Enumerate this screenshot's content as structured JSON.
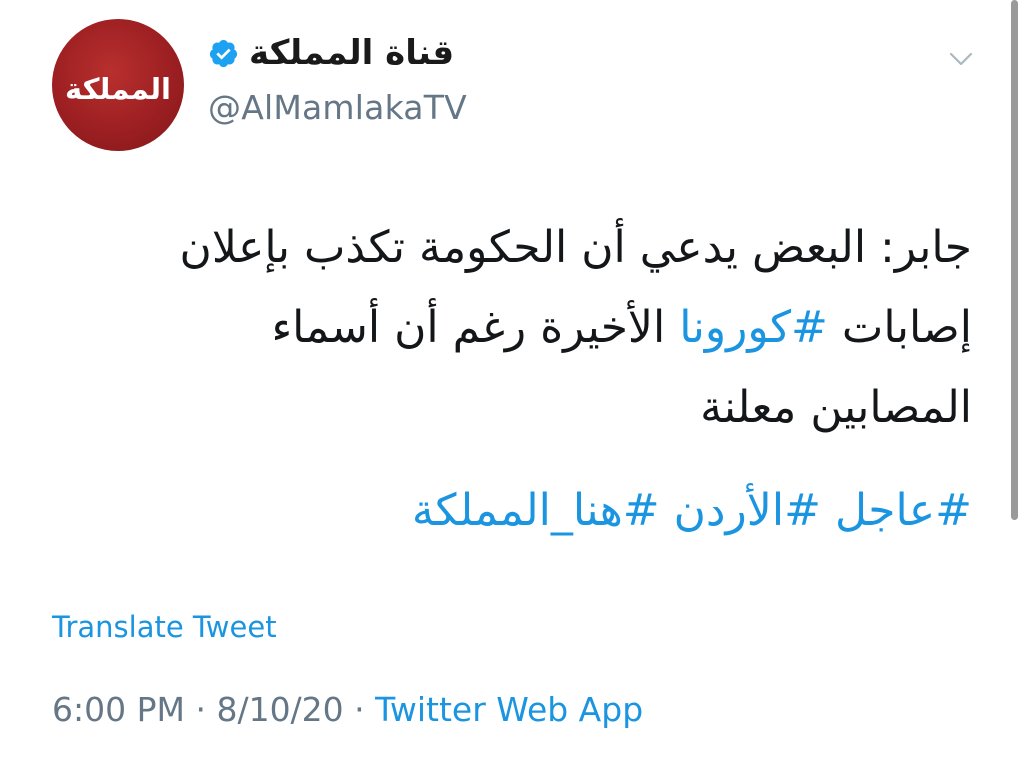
{
  "account": {
    "display_name": "قناة المملكة",
    "handle": "@AlMamlakaTV",
    "verified": true,
    "avatar_text": "المملكة",
    "avatar_color": "#9d1f22",
    "verified_icon": "verified-badge-icon"
  },
  "menu": {
    "icon": "chevron-down-icon"
  },
  "tweet": {
    "line1": "جابر: البعض يدعي أن الحكومة تكذب بإعلان",
    "line2_before": "إصابات ",
    "line2_hashtag": "#كورونا",
    "line2_after": " الأخيرة رغم أن أسماء",
    "line3": "المصابين معلنة",
    "hashtags": "#عاجل #الأردن #هنا_المملكة"
  },
  "actions": {
    "translate_label": "Translate Tweet"
  },
  "meta": {
    "time": "6:00 PM",
    "sep1": " · ",
    "date": "8/10/20",
    "sep2": " · ",
    "source": "Twitter Web App"
  },
  "colors": {
    "link": "#1b95e0",
    "secondary_text": "#657786",
    "primary_text": "#14171a"
  }
}
